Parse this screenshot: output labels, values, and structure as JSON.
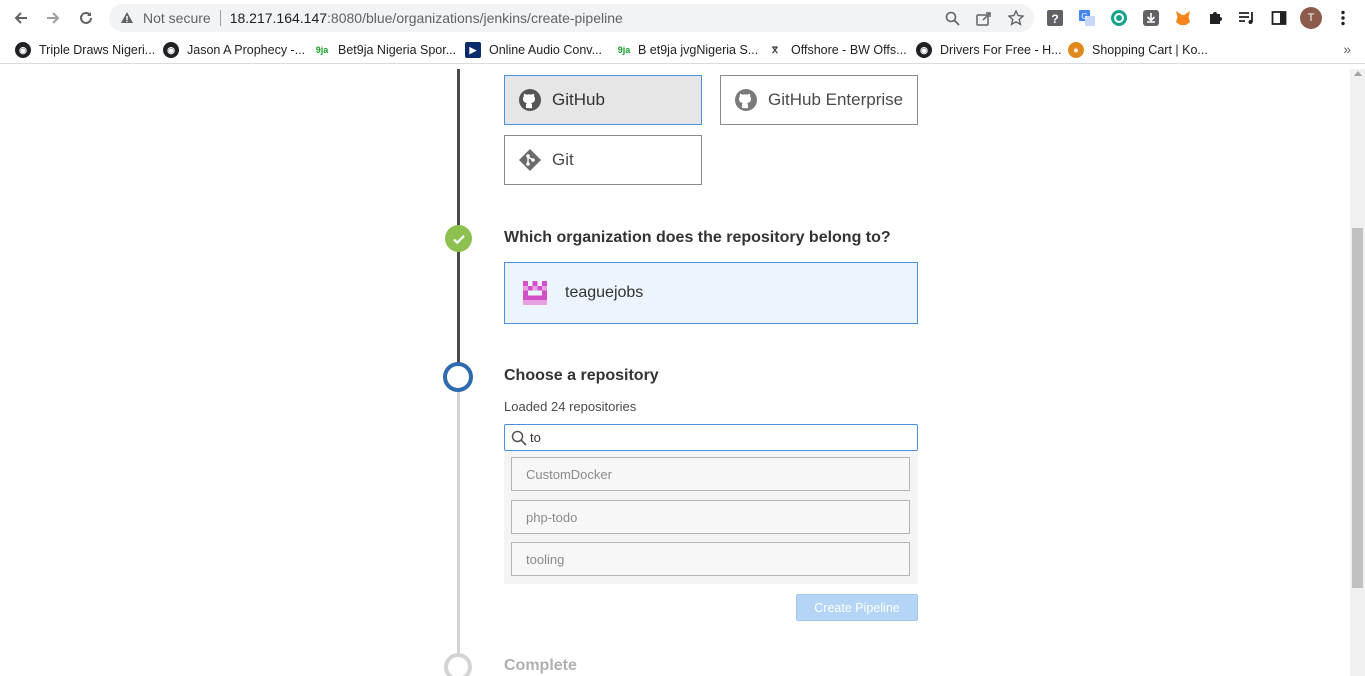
{
  "browser": {
    "security_label": "Not secure",
    "url_host": "18.217.164.147",
    "url_rest": ":8080/blue/organizations/jenkins/create-pipeline",
    "profile_initial": "T"
  },
  "bookmarks": [
    {
      "label": "Triple Draws Nigeri...",
      "icon": "globe-icon"
    },
    {
      "label": "Jason A Prophecy -...",
      "icon": "globe-icon"
    },
    {
      "label": "Bet9ja Nigeria Spor...",
      "icon": "9ja-icon"
    },
    {
      "label": "Online Audio Conv...",
      "icon": "play-icon"
    },
    {
      "label": "B et9ja jvgNigeria S...",
      "icon": "9ja-icon"
    },
    {
      "label": "Offshore - BW Offs...",
      "icon": "offshore-icon"
    },
    {
      "label": "Drivers For Free - H...",
      "icon": "globe-icon"
    },
    {
      "label": "Shopping Cart | Ko...",
      "icon": "shop-icon"
    }
  ],
  "scm": {
    "github": "GitHub",
    "github_enterprise": "GitHub Enterprise",
    "git": "Git"
  },
  "org_step": {
    "title": "Which organization does the repository belong to?",
    "org_name": "teaguejobs"
  },
  "repo_step": {
    "title": "Choose a repository",
    "loaded_text": "Loaded 24 repositories",
    "search_value": "to",
    "repos": [
      "CustomDocker",
      "php-todo",
      "tooling"
    ],
    "create_button": "Create Pipeline"
  },
  "complete_step": {
    "title": "Complete"
  },
  "colors": {
    "accent": "#4a90e2",
    "done": "#8cc04f",
    "active_ring": "#2e6ab0"
  }
}
